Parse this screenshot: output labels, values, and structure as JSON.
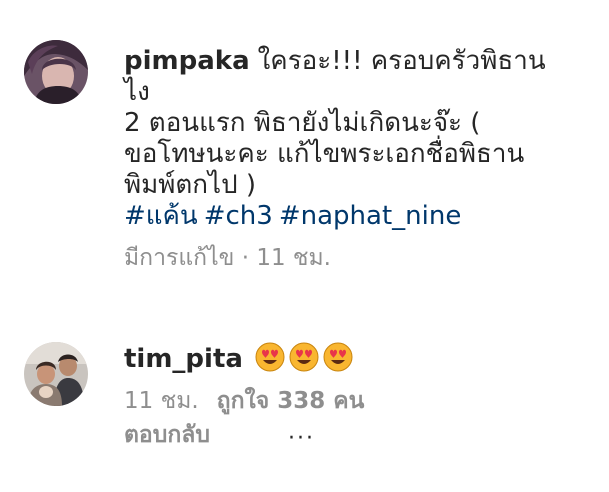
{
  "comments": [
    {
      "username": "pimpaka",
      "text_lines": [
        "ใครอะ!!! ครอบครัวพิธาน",
        "ไง",
        "2 ตอนแรก พิธายังไม่เกิดนะจ๊ะ (",
        "ขอโทษนะคะ แก้ไขพระเอกชื่อพิธาน",
        "พิมพ์ตกไป )"
      ],
      "hashtags": [
        "#แค้น",
        "#ch3",
        "#naphat_nine"
      ],
      "meta": "มีการแก้ไข · 11 ชม."
    },
    {
      "username": "tim_pita",
      "emojis": [
        "heart-eyes-emoji",
        "heart-eyes-emoji",
        "heart-eyes-emoji"
      ],
      "time": "11 ชม.",
      "likes": "ถูกใจ 338 คน",
      "reply": "ตอบกลับ",
      "more": "···"
    }
  ],
  "colors": {
    "text": "#262626",
    "hashtag": "#00376b",
    "meta": "#8e8e8e",
    "emoji_face": "#f9b630",
    "emoji_heart": "#e8354a"
  }
}
